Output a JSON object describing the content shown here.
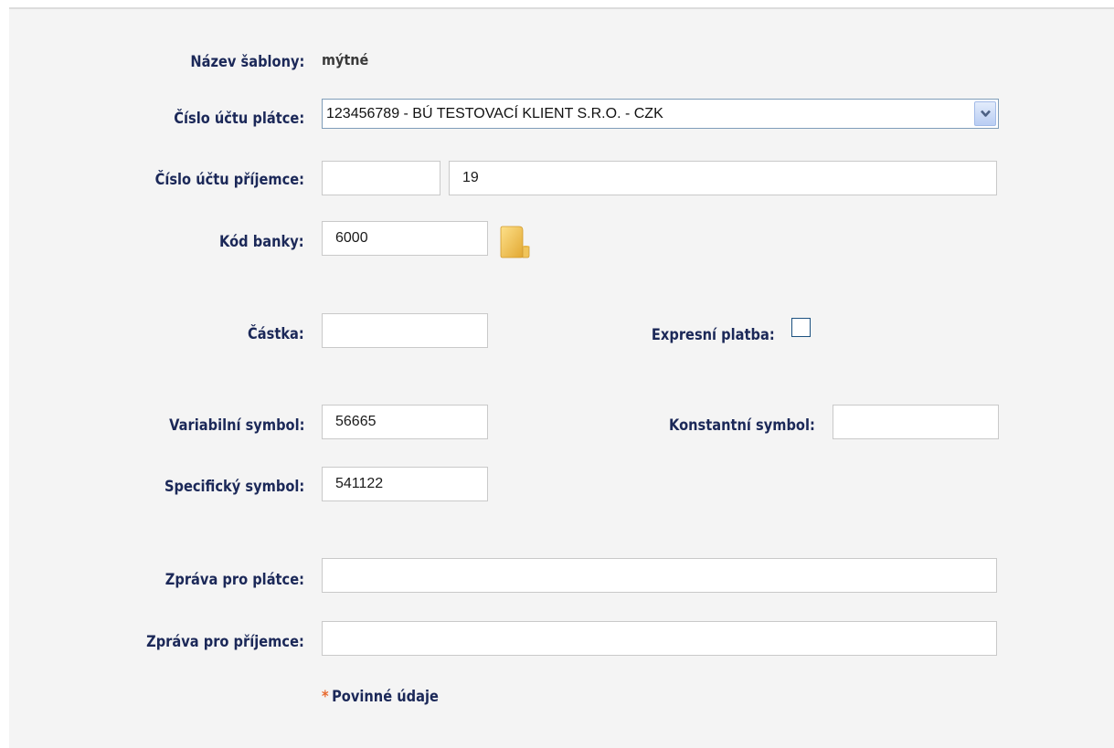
{
  "form": {
    "template_name_label": "Název šablony:",
    "template_name_value": "mýtné",
    "payer_account_label": "Číslo účtu plátce:",
    "payer_account_selected": "123456789 - BÚ TESTOVACÍ KLIENT S.R.O. - CZK",
    "payee_account_label": "Číslo účtu příjemce:",
    "payee_account_prefix": "",
    "payee_account_number": "19",
    "bank_code_label": "Kód banky:",
    "bank_code_value": "6000",
    "amount_label": "Částka:",
    "amount_value": "",
    "express_label": "Expresní platba:",
    "express_checked": false,
    "variable_symbol_label": "Variabilní symbol:",
    "variable_symbol_value": "56665",
    "constant_symbol_label": "Konstantní symbol:",
    "constant_symbol_value": "",
    "specific_symbol_label": "Specifický symbol:",
    "specific_symbol_value": "541122",
    "payer_message_label": "Zpráva pro plátce:",
    "payer_message_value": "",
    "payee_message_label": "Zpráva pro příjemce:",
    "payee_message_value": "",
    "required_star": "*",
    "required_note": "Povinné údaje"
  },
  "icons": {
    "dropdown": "chevron-down-icon",
    "bank_lookup": "folder-icon"
  },
  "colors": {
    "label": "#1b2858",
    "required_star": "#e8692e",
    "panel_background": "#f4f4f4"
  }
}
